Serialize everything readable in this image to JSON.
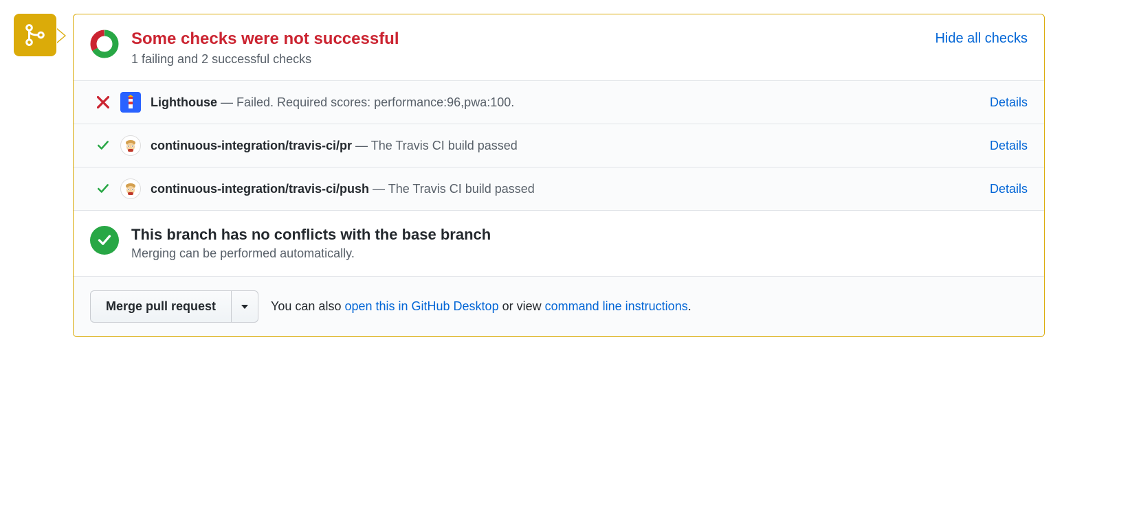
{
  "header": {
    "title": "Some checks were not successful",
    "subtitle": "1 failing and 2 successful checks",
    "toggle_label": "Hide all checks"
  },
  "checks": [
    {
      "status": "fail",
      "avatar": "lighthouse",
      "name": "Lighthouse",
      "separator": " — ",
      "description": "Failed. Required scores: performance:96,pwa:100.",
      "details_label": "Details"
    },
    {
      "status": "pass",
      "avatar": "travis",
      "name": "continuous-integration/travis-ci/pr",
      "separator": " — ",
      "description": "The Travis CI build passed",
      "details_label": "Details"
    },
    {
      "status": "pass",
      "avatar": "travis",
      "name": "continuous-integration/travis-ci/push",
      "separator": " — ",
      "description": "The Travis CI build passed",
      "details_label": "Details"
    }
  ],
  "conflict": {
    "title": "This branch has no conflicts with the base branch",
    "subtitle": "Merging can be performed automatically."
  },
  "merge": {
    "button_label": "Merge pull request",
    "note_prefix": "You can also ",
    "desktop_link": "open this in GitHub Desktop",
    "note_middle": " or view ",
    "cli_link": "command line instructions",
    "note_suffix": "."
  }
}
